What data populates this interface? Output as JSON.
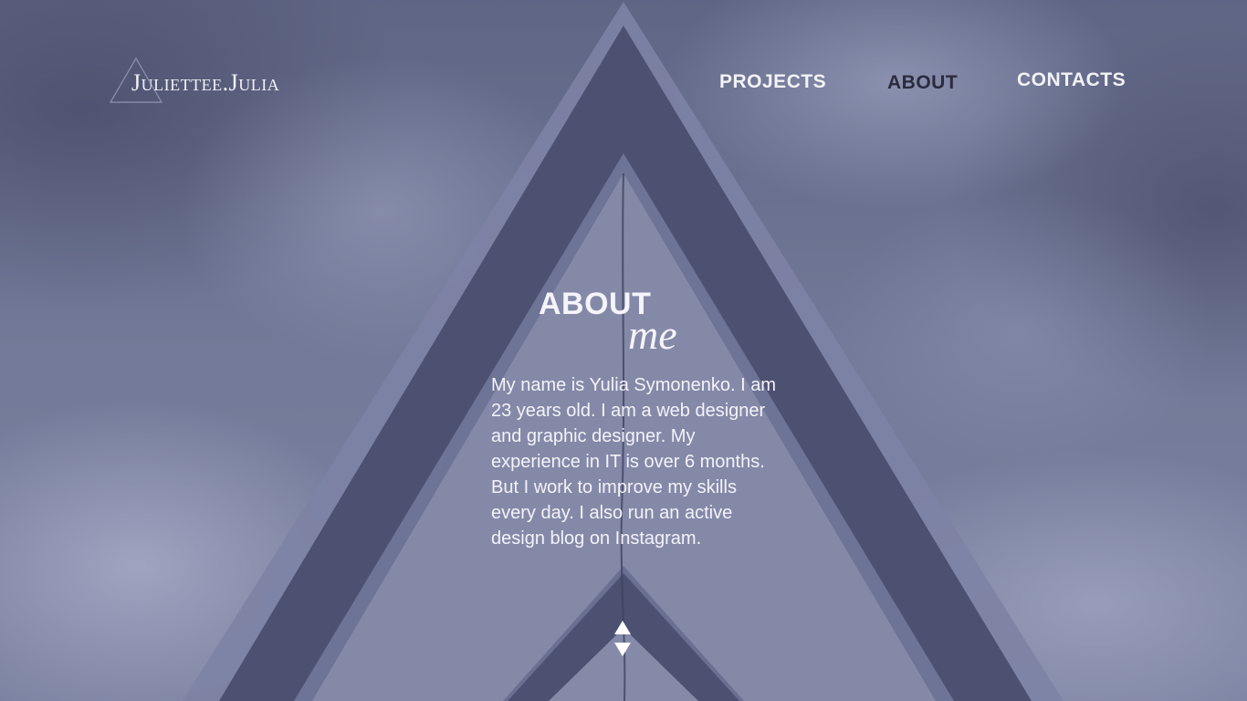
{
  "logo": {
    "text": "Juliettee.Julia"
  },
  "nav": {
    "items": [
      {
        "label": "PROJECTS"
      },
      {
        "label": "ABOUT"
      },
      {
        "label": "CONTACTS"
      }
    ],
    "active": "ABOUT"
  },
  "about": {
    "title": "ABOUT",
    "subtitle": "me",
    "bio": "My name is Yulia Symonenko. I am 23 years old. I am a web designer and graphic designer. My experience in IT is over 6 months. But I work to improve my skills every day. I also run an active design blog on Instagram."
  },
  "scroll": {
    "up_icon": "arrow-up-icon",
    "down_icon": "arrow-down-icon"
  },
  "colors": {
    "background": "#6d7391",
    "triangle_band": "#4e5272",
    "triangle_edge": "#7c82a3",
    "text": "#f3f3f8",
    "nav_active": "#2a2c3c"
  }
}
